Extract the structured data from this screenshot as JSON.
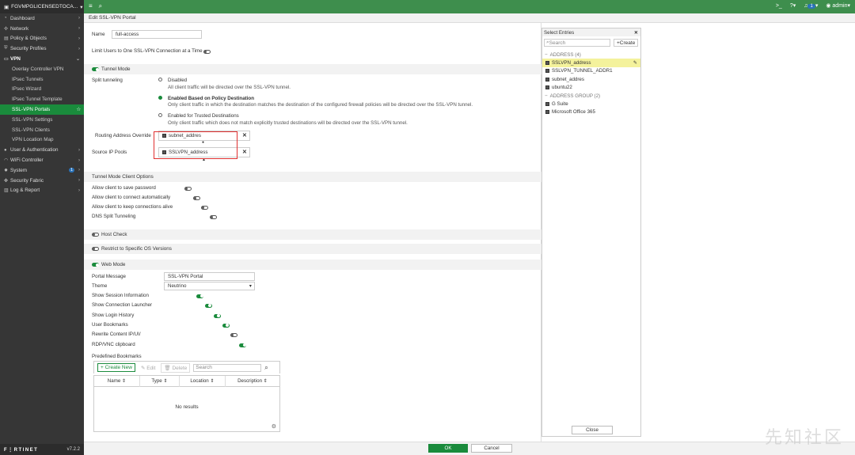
{
  "topbar": {
    "hostname": "FGVMPGLICENSEDTOCA...",
    "user": "admin",
    "notif_count": "1",
    "menu_icon": "hamburger-icon",
    "search_icon": "search-icon",
    "cli_icon": ">_",
    "help_icon": "?",
    "bell_icon": "bell-icon"
  },
  "sidebar": {
    "items": [
      {
        "label": "Dashboard",
        "icon": "dashboard-icon",
        "arrow": "›"
      },
      {
        "label": "Network",
        "icon": "network-icon",
        "arrow": "›"
      },
      {
        "label": "Policy & Objects",
        "icon": "policy-icon",
        "arrow": "›"
      },
      {
        "label": "Security Profiles",
        "icon": "shield-icon",
        "arrow": "›"
      },
      {
        "label": "VPN",
        "icon": "vpn-icon",
        "arrow": "⌄"
      }
    ],
    "vpn_sub": [
      "Overlay Controller VPN",
      "IPsec Tunnels",
      "IPsec Wizard",
      "IPsec Tunnel Template",
      "SSL-VPN Portals",
      "SSL-VPN Settings",
      "SSL-VPN Clients",
      "VPN Location Map"
    ],
    "items2": [
      {
        "label": "User & Authentication",
        "icon": "user-icon",
        "arrow": "›"
      },
      {
        "label": "WiFi Controller",
        "icon": "wifi-icon",
        "arrow": "›"
      },
      {
        "label": "System",
        "icon": "gear-icon",
        "arrow": "›",
        "count": "1"
      },
      {
        "label": "Security Fabric",
        "icon": "fabric-icon",
        "arrow": "›"
      },
      {
        "label": "Log & Report",
        "icon": "chart-icon",
        "arrow": "›"
      }
    ],
    "brand": "F⋮RTINET",
    "version": "v7.2.2"
  },
  "header": {
    "title": "Edit SSL-VPN Portal"
  },
  "form": {
    "name_label": "Name",
    "name_value": "full-access",
    "limit_label": "Limit Users to One SSL-VPN Connection at a Time",
    "tunnel_mode": "Tunnel Mode",
    "split_label": "Split tunneling",
    "opt1_title": "Disabled",
    "opt1_desc": "All client traffic will be directed over the SSL-VPN tunnel.",
    "opt2_title": "Enabled Based on Policy Destination",
    "opt2_desc": "Only client traffic in which the destination matches the destination of the configured firewall policies will be directed over the SSL-VPN tunnel.",
    "opt3_title": "Enabled for Trusted Destinations",
    "opt3_desc": "Only client traffic which does not match explicitly trusted destinations will be directed over the SSL-VPN tunnel.",
    "routing_label": "Routing Address Override",
    "routing_value": "subnet_addres",
    "pools_label": "Source IP Pools",
    "pools_value": "SSLVPN_address",
    "client_opts": "Tunnel Mode Client Options",
    "c1": "Allow client to save password",
    "c2": "Allow client to connect automatically",
    "c3": "Allow client to keep connections alive",
    "c4": "DNS Split Tunneling",
    "host_check": "Host Check",
    "restrict_os": "Restrict to Specific OS Versions",
    "web_mode": "Web Mode",
    "portal_msg_label": "Portal Message",
    "portal_msg_value": "SSL-VPN Portal",
    "theme_label": "Theme",
    "theme_value": "Neutrino",
    "w1": "Show Session Information",
    "w2": "Show Connection Launcher",
    "w3": "Show Login History",
    "w4": "User Bookmarks",
    "w5": "Rewrite Content IP/UI/",
    "w6": "RDP/VNC clipboard",
    "bookmarks_label": "Predefined Bookmarks",
    "create_new": "Create New",
    "edit": "Edit",
    "delete": "Delete",
    "search_ph": "Search",
    "columns": [
      "Name ⇕",
      "Type ⇕",
      "Location ⇕",
      "Description ⇕"
    ],
    "no_results": "No results"
  },
  "panel": {
    "title": "Select Entries",
    "search_ph": "Search",
    "create": "Create",
    "rows": [
      {
        "label": "ADDRESS (4)",
        "kind": "grp"
      },
      {
        "label": "SSLVPN_address",
        "kind": "sel"
      },
      {
        "label": "SSLVPN_TUNNEL_ADDR1",
        "kind": "item"
      },
      {
        "label": "subnet_addres",
        "kind": "item"
      },
      {
        "label": "ubuntu22",
        "kind": "item"
      },
      {
        "label": "ADDRESS GROUP (2)",
        "kind": "grp"
      },
      {
        "label": "G Suite",
        "kind": "item"
      },
      {
        "label": "Microsoft Office 365",
        "kind": "item"
      }
    ],
    "close": "Close"
  },
  "footer": {
    "ok": "OK",
    "cancel": "Cancel"
  },
  "watermark": "先知社区",
  "colors": {
    "accent": "#1a8b3c",
    "topbar": "#3e8e4d",
    "sidebar": "#363636",
    "highlight": "#e03030"
  }
}
